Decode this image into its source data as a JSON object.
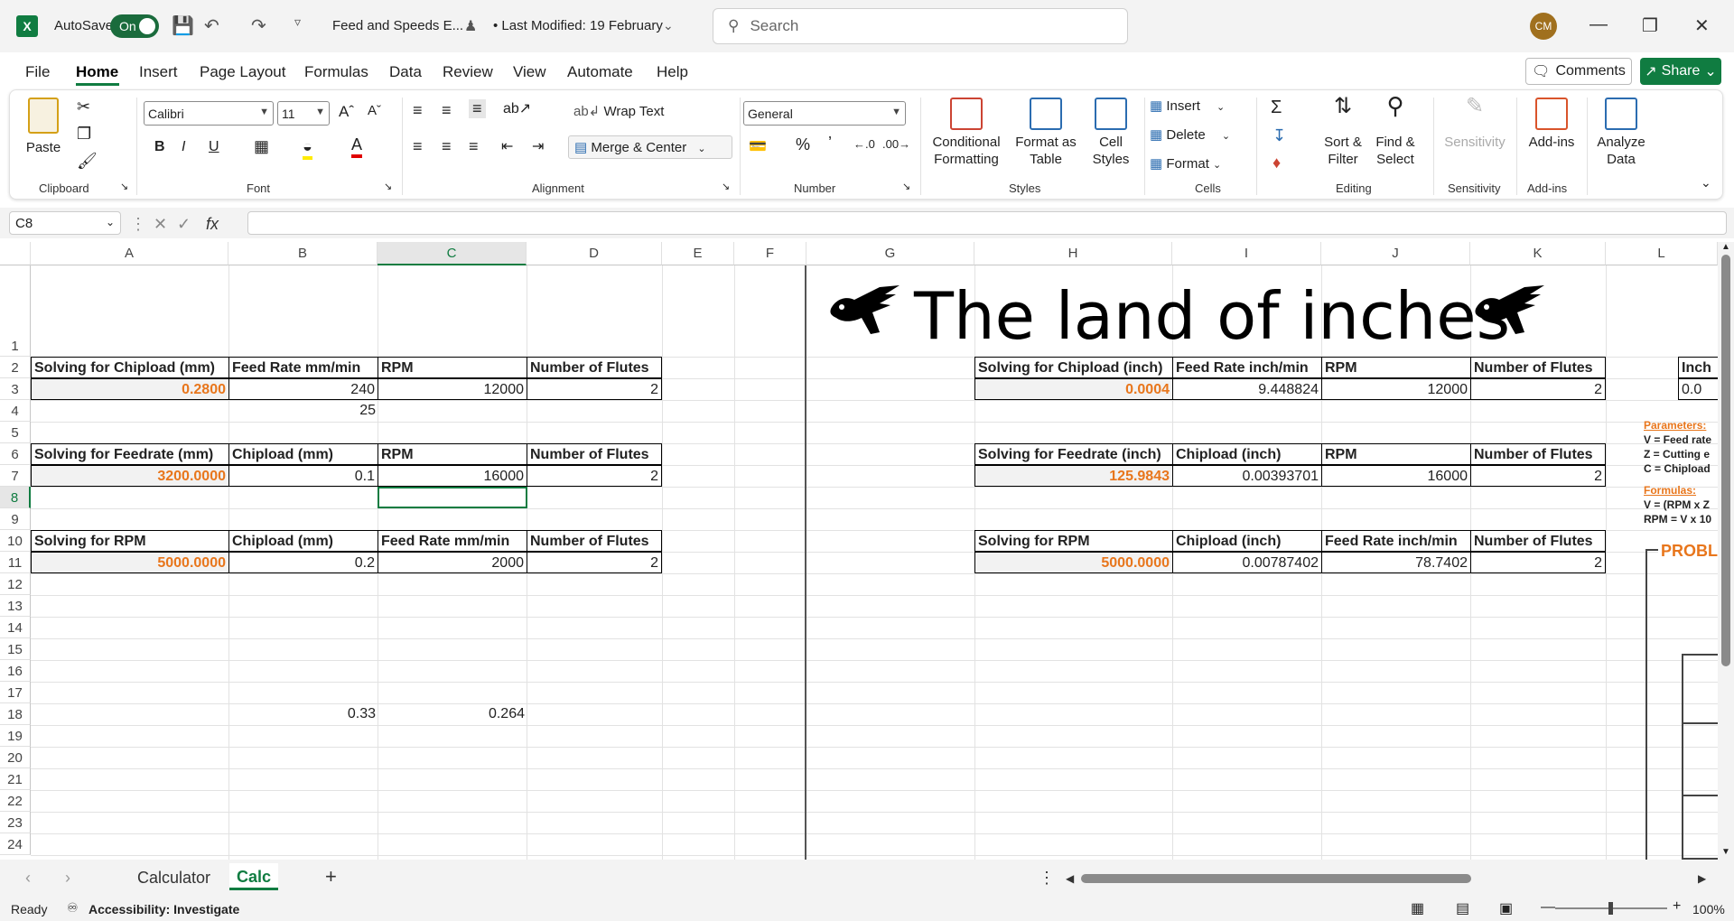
{
  "titlebar": {
    "logo": "X",
    "autosave_label": "AutoSave",
    "autosave_state": "On",
    "doc_title": "Feed and Speeds E...",
    "modified": "• Last Modified: 19 February",
    "search_placeholder": "Search",
    "avatar_initials": "CM"
  },
  "menu": {
    "tabs": [
      "File",
      "Home",
      "Insert",
      "Page Layout",
      "Formulas",
      "Data",
      "Review",
      "View",
      "Automate",
      "Help"
    ],
    "comments": "Comments",
    "share": "Share"
  },
  "ribbon": {
    "clipboard": {
      "paste": "Paste",
      "label": "Clipboard"
    },
    "font": {
      "name": "Calibri",
      "size": "11",
      "label": "Font",
      "bold": "B",
      "italic": "I",
      "underline": "U"
    },
    "alignment": {
      "wrap": "Wrap Text",
      "merge": "Merge & Center",
      "label": "Alignment"
    },
    "number": {
      "format": "General",
      "label": "Number"
    },
    "styles": {
      "conditional": "Conditional Formatting",
      "format_table": "Format as Table",
      "cell_styles": "Cell Styles",
      "label": "Styles"
    },
    "cells": {
      "insert": "Insert",
      "delete": "Delete",
      "format": "Format",
      "label": "Cells"
    },
    "editing": {
      "sort": "Sort & Filter",
      "find": "Find & Select",
      "label": "Editing"
    },
    "sensitivity": {
      "btn": "Sensitivity",
      "label": "Sensitivity"
    },
    "addins": {
      "btn": "Add-ins",
      "label": "Add-ins"
    },
    "analyze": {
      "btn": "Analyze Data"
    }
  },
  "formula_bar": {
    "name_box": "C8",
    "fx": "fx",
    "content": ""
  },
  "columns": [
    "A",
    "B",
    "C",
    "D",
    "E",
    "F",
    "G",
    "H",
    "I",
    "J",
    "K",
    "L"
  ],
  "rows": [
    "1",
    "2",
    "3",
    "4",
    "5",
    "6",
    "7",
    "8",
    "9",
    "10",
    "11",
    "12",
    "13",
    "14",
    "15",
    "16",
    "17",
    "18",
    "19",
    "20",
    "21",
    "22",
    "23",
    "24"
  ],
  "sheet": {
    "title": "The land of inches",
    "mm": {
      "chipload": {
        "headers": [
          "Solving for Chipload (mm)",
          "Feed Rate mm/min",
          "RPM",
          "Number of Flutes"
        ],
        "values": [
          "0.2800",
          "240",
          "12000",
          "2"
        ],
        "extra": "25"
      },
      "feedrate": {
        "headers": [
          "Solving for Feedrate (mm)",
          "Chipload (mm)",
          "RPM",
          "Number of Flutes"
        ],
        "values": [
          "3200.0000",
          "0.1",
          "16000",
          "2"
        ]
      },
      "rpm": {
        "headers": [
          "Solving for RPM",
          "Chipload (mm)",
          "Feed Rate mm/min",
          "Number of Flutes"
        ],
        "values": [
          "5000.0000",
          "0.2",
          "2000",
          "2"
        ]
      },
      "row18": [
        "0.33",
        "0.264"
      ]
    },
    "inch": {
      "chipload": {
        "headers": [
          "Solving for Chipload (inch)",
          "Feed Rate inch/min",
          "RPM",
          "Number of Flutes"
        ],
        "values": [
          "0.0004",
          "9.448824",
          "12000",
          "2"
        ]
      },
      "feedrate": {
        "headers": [
          "Solving for Feedrate (inch)",
          "Chipload (inch)",
          "RPM",
          "Number of Flutes"
        ],
        "values": [
          "125.9843",
          "0.00393701",
          "16000",
          "2"
        ]
      },
      "rpm": {
        "headers": [
          "Solving for RPM",
          "Chipload (inch)",
          "Feed Rate inch/min",
          "Number of Flutes"
        ],
        "values": [
          "5000.0000",
          "0.00787402",
          "78.7402",
          "2"
        ]
      }
    },
    "side": {
      "l2": "Inch",
      "l3": "0.0",
      "params_title": "Parameters:",
      "params": [
        "V = Feed rate",
        "Z = Cutting e",
        "C = Chipload"
      ],
      "formulas_title": "Formulas:",
      "formulas": [
        "V = (RPM x Z",
        "RPM = V x 10"
      ],
      "problem": "PROBL"
    }
  },
  "sheets": {
    "tabs": [
      "Calculator",
      "Calc"
    ],
    "active": "Calc",
    "add": "+"
  },
  "status": {
    "ready": "Ready",
    "accessibility": "Accessibility: Investigate",
    "zoom": "100%"
  },
  "colors": {
    "accent": "#107c41",
    "orange": "#e8761c"
  }
}
